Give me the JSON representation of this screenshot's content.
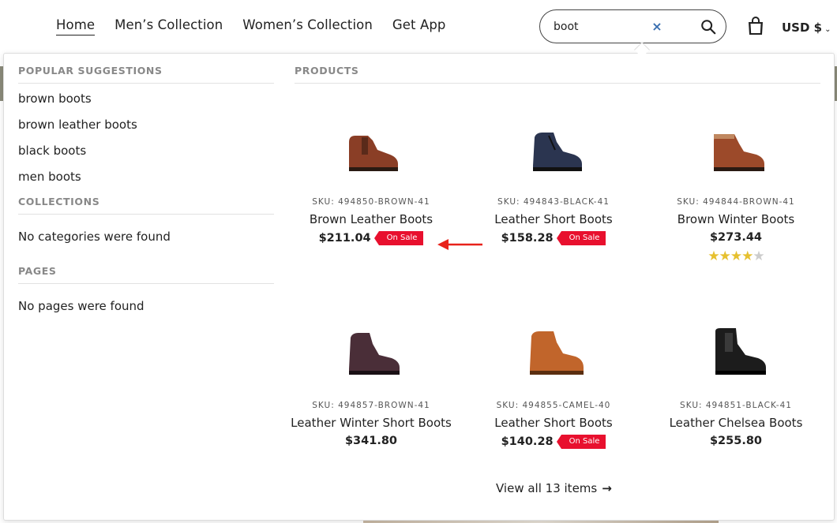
{
  "nav": {
    "items": [
      {
        "label": "Home",
        "active": true
      },
      {
        "label": "Men’s Collection"
      },
      {
        "label": "Women’s Collection"
      },
      {
        "label": "Get App"
      }
    ]
  },
  "search": {
    "value": "boot",
    "clear_icon": "close-icon",
    "search_icon": "search-icon"
  },
  "header": {
    "cart_icon": "shopping-bag-icon",
    "currency": "USD $"
  },
  "suggestions": {
    "title": "POPULAR SUGGESTIONS",
    "items": [
      "brown boots",
      "brown leather boots",
      "black boots",
      "men boots"
    ]
  },
  "collections": {
    "title": "COLLECTIONS",
    "empty": "No categories were found"
  },
  "pages": {
    "title": "PAGES",
    "empty": "No pages were found"
  },
  "products": {
    "title": "PRODUCTS",
    "items": [
      {
        "sku": "SKU: 494850-BROWN-41",
        "name": "Brown Leather Boots",
        "price": "$211.04",
        "badge": "On Sale",
        "color": "#8a3e26"
      },
      {
        "sku": "SKU: 494843-BLACK-41",
        "name": "Leather Short Boots",
        "price": "$158.28",
        "badge": "On Sale",
        "color": "#2b3550"
      },
      {
        "sku": "SKU: 494844-BROWN-41",
        "name": "Brown Winter Boots",
        "price": "$273.44",
        "rating": 4,
        "rating_max": 5,
        "color": "#9c4a2a"
      },
      {
        "sku": "SKU: 494857-BROWN-41",
        "name": "Leather Winter Short Boots",
        "price": "$341.80",
        "color": "#4a2e38"
      },
      {
        "sku": "SKU: 494855-CAMEL-40",
        "name": "Leather Short Boots",
        "price": "$140.28",
        "badge": "On Sale",
        "color": "#c1652b"
      },
      {
        "sku": "SKU: 494851-BLACK-41",
        "name": "Leather Chelsea Boots",
        "price": "$255.80",
        "color": "#1c1c1c"
      }
    ],
    "view_all": "View all 13 items"
  },
  "colors": {
    "sale_badge": "#e8102e",
    "annotation_arrow": "#e8221a",
    "star": "#e6c02f"
  }
}
